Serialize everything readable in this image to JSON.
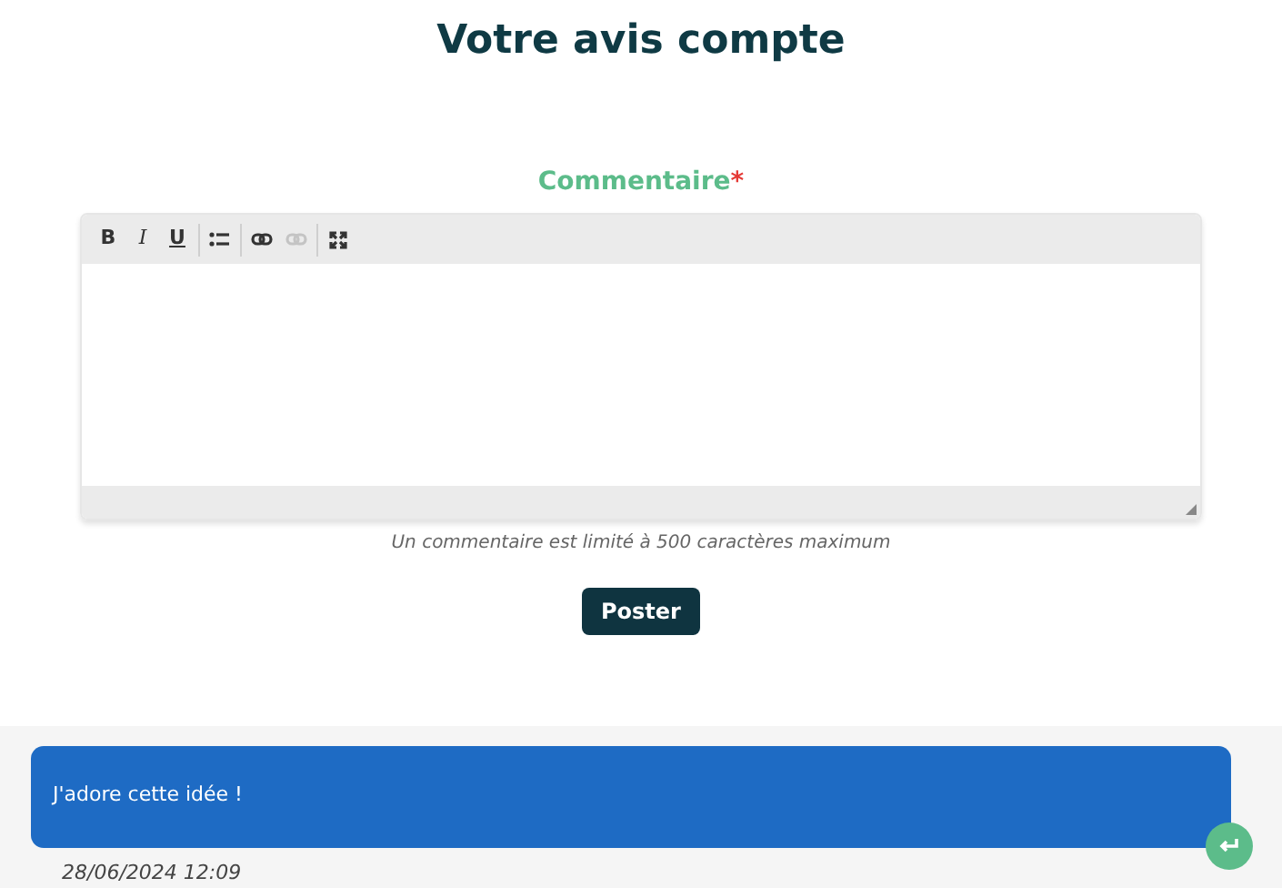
{
  "title": "Votre avis compte",
  "form": {
    "label": "Commentaire",
    "required_mark": "*",
    "toolbar_groups": [
      [
        {
          "kind": "bold",
          "label": "B",
          "disabled": false
        },
        {
          "kind": "italic",
          "label": "I",
          "disabled": false
        },
        {
          "kind": "underline",
          "label": "U",
          "disabled": false
        }
      ],
      [
        {
          "kind": "list",
          "disabled": false
        }
      ],
      [
        {
          "kind": "link",
          "disabled": false
        },
        {
          "kind": "unlink",
          "disabled": true
        }
      ],
      [
        {
          "kind": "fullscreen",
          "disabled": false
        }
      ]
    ],
    "hint": "Un commentaire est limité à 500 caractères maximum",
    "submit": "Poster"
  },
  "comments": [
    {
      "text": "J'adore cette idée !",
      "date": "28/06/2024 12:09"
    }
  ]
}
